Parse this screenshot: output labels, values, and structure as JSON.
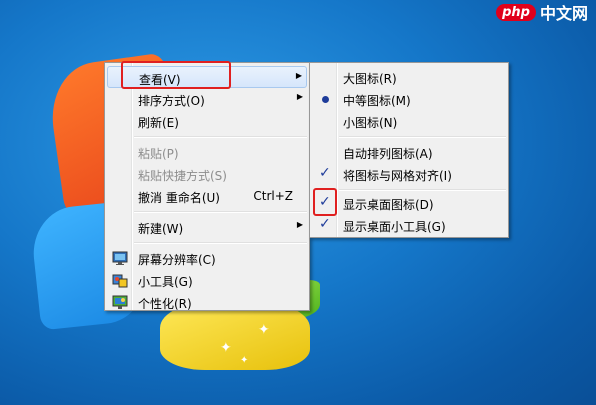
{
  "watermark": {
    "badge": "php",
    "text": "中文网"
  },
  "main_menu": {
    "items": [
      {
        "label": "查看(V)",
        "shortcut": "",
        "has_submenu": true,
        "disabled": false
      },
      {
        "label": "排序方式(O)",
        "shortcut": "",
        "has_submenu": true,
        "disabled": false
      },
      {
        "label": "刷新(E)",
        "shortcut": "",
        "has_submenu": false,
        "disabled": false
      },
      {
        "label": "粘贴(P)",
        "shortcut": "",
        "has_submenu": false,
        "disabled": true
      },
      {
        "label": "粘贴快捷方式(S)",
        "shortcut": "",
        "has_submenu": false,
        "disabled": true
      },
      {
        "label": "撤消 重命名(U)",
        "shortcut": "Ctrl+Z",
        "has_submenu": false,
        "disabled": false
      },
      {
        "label": "新建(W)",
        "shortcut": "",
        "has_submenu": true,
        "disabled": false
      },
      {
        "label": "屏幕分辨率(C)",
        "shortcut": "",
        "has_submenu": false,
        "disabled": false,
        "icon": "display-settings-icon"
      },
      {
        "label": "小工具(G)",
        "shortcut": "",
        "has_submenu": false,
        "disabled": false,
        "icon": "gadgets-icon"
      },
      {
        "label": "个性化(R)",
        "shortcut": "",
        "has_submenu": false,
        "disabled": false,
        "icon": "personalize-icon"
      }
    ]
  },
  "view_submenu": {
    "items": [
      {
        "label": "大图标(R)",
        "state": "none"
      },
      {
        "label": "中等图标(M)",
        "state": "radio"
      },
      {
        "label": "小图标(N)",
        "state": "none"
      },
      {
        "label": "自动排列图标(A)",
        "state": "none"
      },
      {
        "label": "将图标与网格对齐(I)",
        "state": "checked"
      },
      {
        "label": "显示桌面图标(D)",
        "state": "checked"
      },
      {
        "label": "显示桌面小工具(G)",
        "state": "checked"
      }
    ]
  },
  "colors": {
    "highlight_box": "#e02020",
    "check_mark": "#1e3c9a",
    "desktop_blue": "#1577c9"
  }
}
